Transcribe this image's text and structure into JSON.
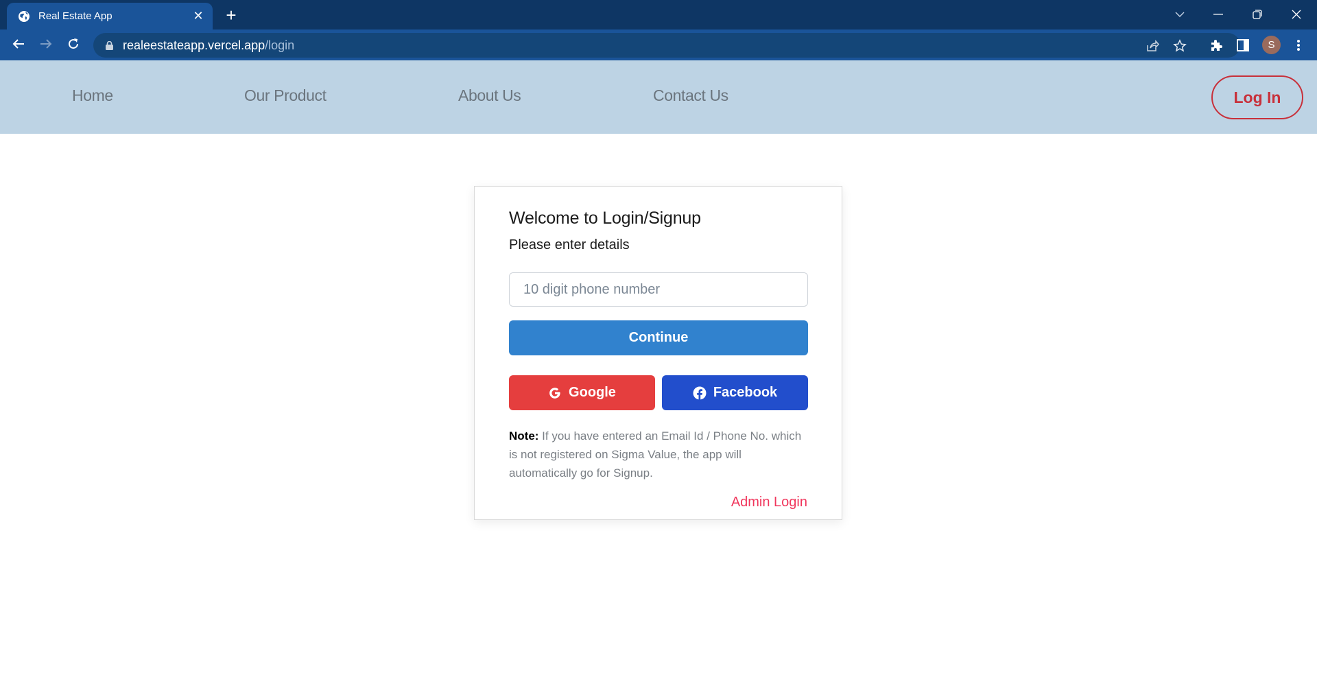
{
  "browser": {
    "tab_title": "Real Estate App",
    "url_host": "realeestateapp.vercel.app",
    "url_path": "/login",
    "profile_initial": "S"
  },
  "nav": {
    "links": [
      "Home",
      "Our Product",
      "About Us",
      "Contact Us"
    ],
    "login_label": "Log In"
  },
  "card": {
    "title": "Welcome to Login/Signup",
    "subtitle": "Please enter details",
    "phone_placeholder": "10 digit phone number",
    "phone_value": "",
    "continue_label": "Continue",
    "google_label": "Google",
    "facebook_label": "Facebook",
    "note_label": "Note:",
    "note_text": " If you have entered an Email Id / Phone No. which is not registered on Sigma Value, the app will automatically go for Signup.",
    "admin_login_label": "Admin Login"
  },
  "colors": {
    "chrome_titlebar": "#0e3664",
    "chrome_toolbar": "#1a5499",
    "nav_bg": "#bdd3e4",
    "login_accent": "#c8303a",
    "continue_bg": "#3182ce",
    "google_bg": "#e53e3e",
    "facebook_bg": "#224ecc",
    "admin_link": "#f0365c"
  }
}
